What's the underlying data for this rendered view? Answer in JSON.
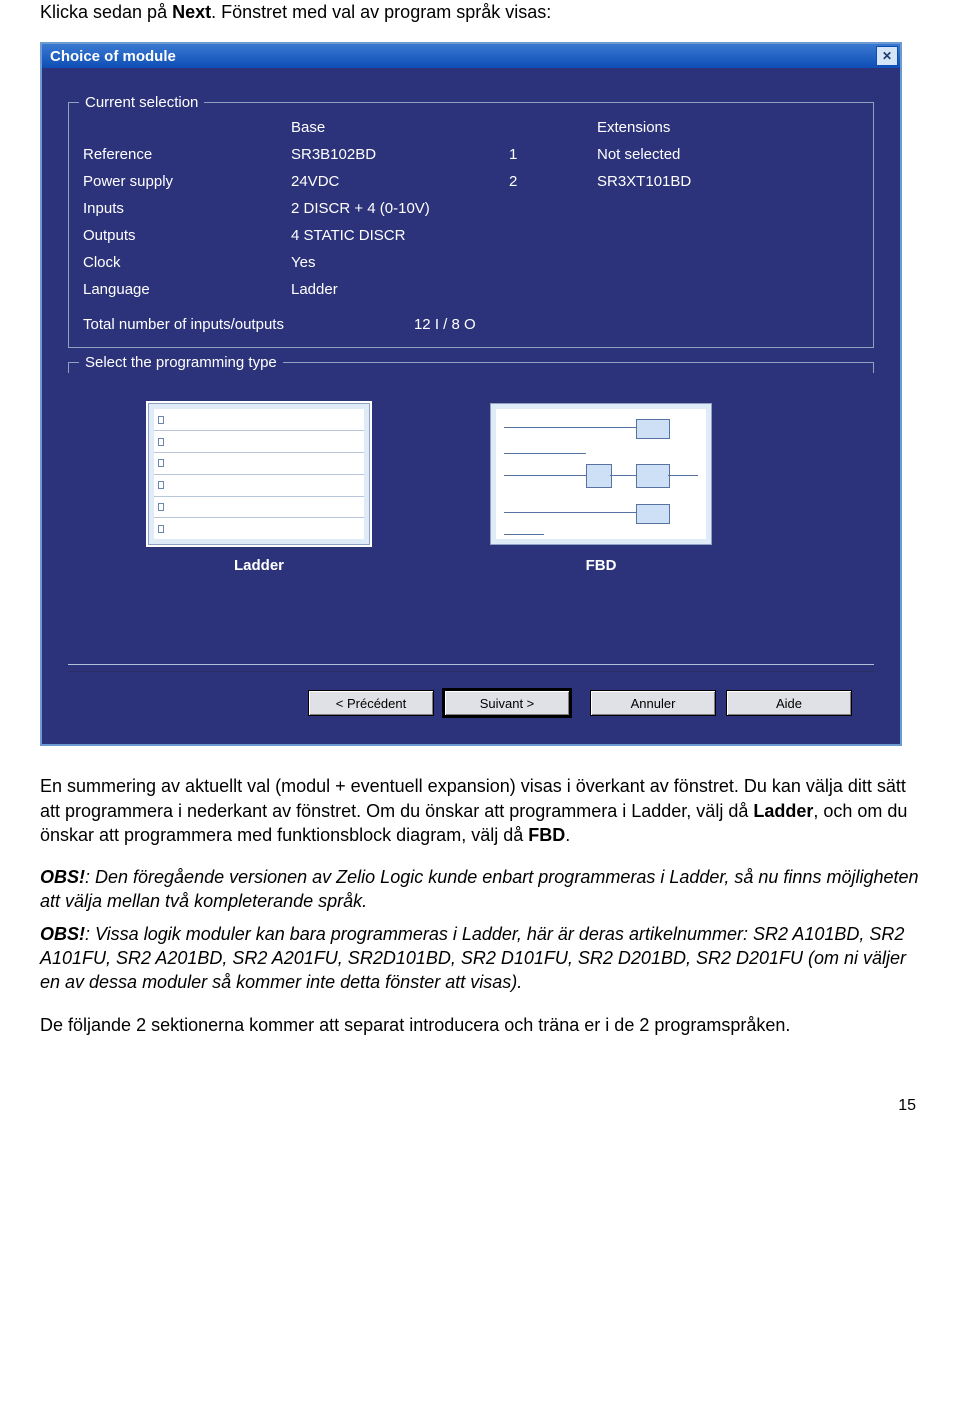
{
  "doc": {
    "intro_line": "Klicka sedan på Next. Fönstret med val av program språk visas:",
    "p1": "En summering av aktuellt val (modul + eventuell expansion) visas i överkant av fönstret. Du kan välja ditt sätt att programmera i nederkant av fönstret. Om du önskar att programmera i Ladder, välj då Ladder, och om du önskar att programmera med funktionsblock diagram, välj då FBD.",
    "obs1_label": "OBS!",
    "obs1_text": ": Den föregående versionen av Zelio Logic kunde enbart programmeras i Ladder, så nu finns möjligheten att välja mellan två kompleterande språk.",
    "obs2_label": "OBS!",
    "obs2_text": ": Vissa logik moduler kan bara programmeras i Ladder, här är deras artikelnummer: SR2 A101BD, SR2 A101FU, SR2 A201BD, SR2 A201FU, SR2D101BD, SR2 D101FU, SR2 D201BD, SR2 D201FU (om ni väljer en av dessa moduler så kommer inte detta fönster att visas).",
    "p2": "De följande 2 sektionerna kommer att separat introducera och träna er i de 2 programspråken.",
    "page_num": "15"
  },
  "win": {
    "title": "Choice of module",
    "current_selection": {
      "legend": "Current selection",
      "base_header": "Base",
      "ext_header": "Extensions",
      "rows": [
        {
          "label": "Reference",
          "value": "SR3B102BD"
        },
        {
          "label": "Power supply",
          "value": "24VDC"
        },
        {
          "label": "Inputs",
          "value": "2 DISCR + 4 (0-10V)"
        },
        {
          "label": "Outputs",
          "value": "4 STATIC DISCR"
        },
        {
          "label": "Clock",
          "value": "Yes"
        },
        {
          "label": "Language",
          "value": "Ladder"
        }
      ],
      "ext": [
        {
          "num": "1",
          "value": "Not selected"
        },
        {
          "num": "2",
          "value": "SR3XT101BD"
        }
      ],
      "total_label": "Total number of inputs/outputs",
      "total_value": "12 I / 8 O"
    },
    "select_type": {
      "legend": "Select the programming type",
      "ladder_label": "Ladder",
      "fbd_label": "FBD"
    },
    "buttons": {
      "prev": "< Précédent",
      "next": "Suivant >",
      "cancel": "Annuler",
      "help": "Aide"
    }
  }
}
